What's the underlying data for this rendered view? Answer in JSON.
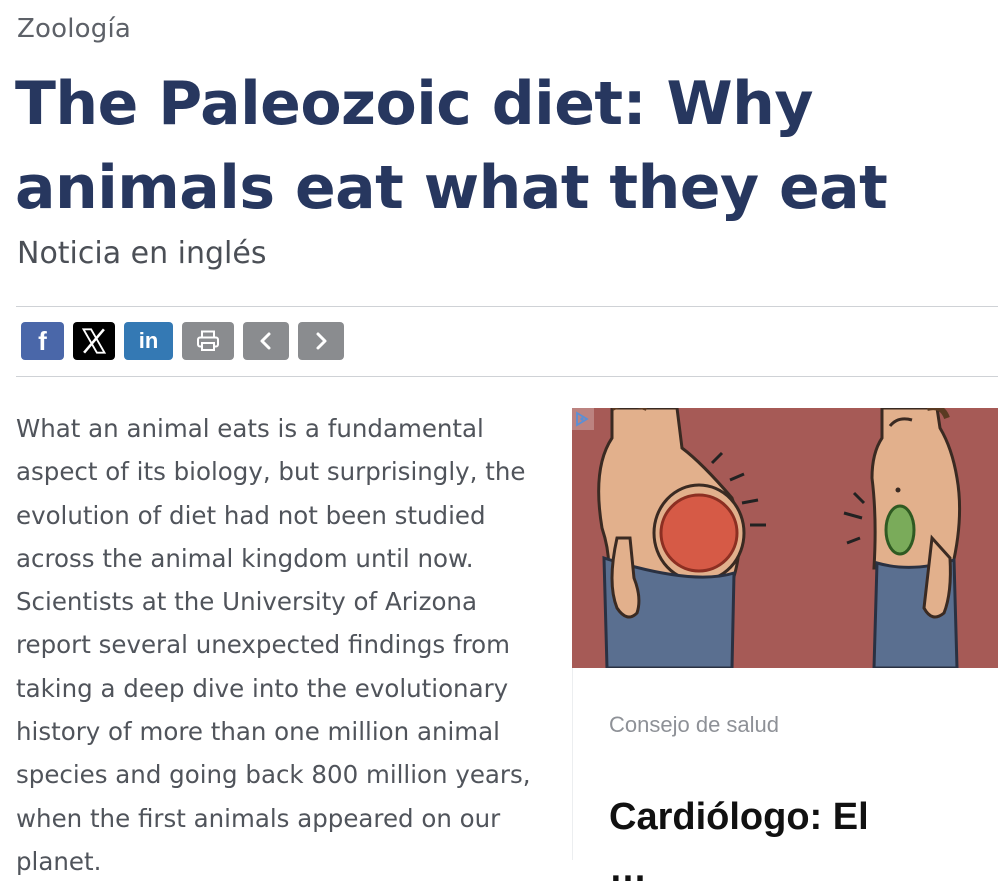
{
  "article": {
    "category": "Zoología",
    "title": "The Paleozoic diet: Why animals eat what they eat",
    "subtitle": "Noticia en inglés",
    "body": "What an animal eats is a fundamental aspect of its biology, but surprisingly, the evolution of diet had not been studied across the animal kingdom until now. Scientists at the University of Arizona report several unexpected findings from taking a deep dive into the evolutionary history of more than one million animal species and going back 800 million years, when the first animals appeared on our planet."
  },
  "share_bar": {
    "buttons": [
      {
        "icon": "facebook-icon",
        "glyph": "f",
        "color": "#4a67a9"
      },
      {
        "icon": "x-icon",
        "color": "#000000"
      },
      {
        "icon": "linkedin-icon",
        "glyph": "in",
        "color": "#3479b4"
      },
      {
        "icon": "print-icon",
        "color": "#8a8c8f"
      },
      {
        "icon": "chevron-left-icon",
        "color": "#8a8c8f"
      },
      {
        "icon": "chevron-right-icon",
        "color": "#8a8c8f"
      }
    ]
  },
  "ad": {
    "label": "Consejo de salud",
    "headline": "Cardiólogo: El",
    "headline_cont": "…",
    "image_bg": "#a65a56"
  },
  "colors": {
    "title": "#27375f",
    "text": "#50545b"
  }
}
